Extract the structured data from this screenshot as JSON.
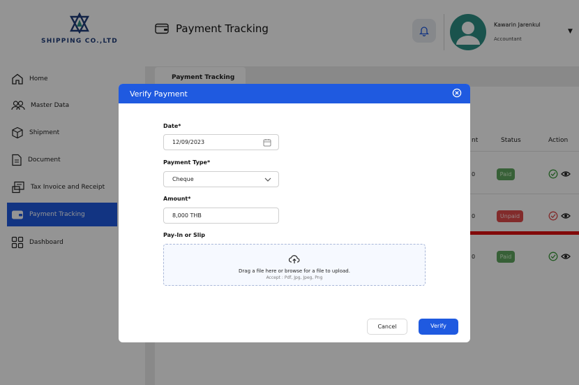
{
  "brand": {
    "logo_text": "SHIPPING CO.,LTD"
  },
  "header": {
    "title": "Payment Tracking"
  },
  "user": {
    "name": "Kawarin Jarenkul",
    "role": "Accountant"
  },
  "sidebar": {
    "items": [
      {
        "label": "Home",
        "icon": "home-icon"
      },
      {
        "label": "Master Data",
        "icon": "users-icon"
      },
      {
        "label": "Shipment",
        "icon": "box-icon"
      },
      {
        "label": "Document",
        "icon": "document-icon"
      },
      {
        "label": "Tax Invoice and Receipt",
        "icon": "receipt-icon"
      },
      {
        "label": "Payment Tracking",
        "icon": "wallet-icon",
        "active": true
      },
      {
        "label": "Dashboard",
        "icon": "dashboard-icon"
      }
    ]
  },
  "main": {
    "tab_label": "Payment Tracking",
    "columns": {
      "amount_cut": "nt",
      "status": "Status",
      "action": "Action"
    },
    "rows": [
      {
        "cut": "0",
        "status": "Paid"
      },
      {
        "cut": "0",
        "status": "Unpaid"
      },
      {
        "cut": "0",
        "status": "Paid"
      }
    ]
  },
  "modal": {
    "title": "Verify Payment",
    "date_label": "Date*",
    "date_value": "12/09/2023",
    "payment_type_label": "Payment Type*",
    "payment_type_value": "Cheque",
    "amount_label": "Amount*",
    "amount_value": "8,000 THB",
    "payin_label": "Pay-In or Slip",
    "drop_main": "Drag a file here or browse for a file to upload.",
    "drop_sub": "Accept : Pdf, Jpg, Jpeg, Png",
    "cancel_label": "Cancel",
    "verify_label": "Verify"
  },
  "colors": {
    "primary": "#1f5ae0",
    "avatar": "#2e8f85",
    "paid": "#5fa55f",
    "unpaid": "#e04a4a",
    "alert_bar": "#e01010"
  }
}
